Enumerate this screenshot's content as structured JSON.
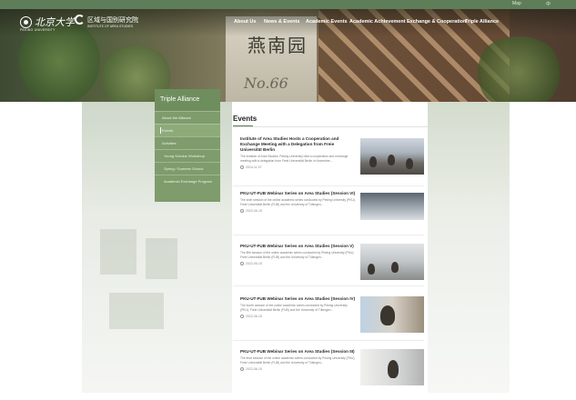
{
  "topbar": {
    "util_links": [
      "Map",
      "中"
    ]
  },
  "logos": {
    "pku_cn": "北京大学",
    "pku_en": "PEKING UNIVERSITY",
    "ias_cn": "区域与国别研究院",
    "ias_en": "INSTITUTE OF AREA STUDIES"
  },
  "nav": {
    "items": [
      "About Us",
      "News & Events",
      "Academic Events",
      "Academic Achievement",
      "Exchange & Cooperation",
      "Triple Alliance"
    ]
  },
  "hero": {
    "door_text": "燕南园",
    "door_number": "No.66"
  },
  "sidebar": {
    "title": "Triple Alliance",
    "items": [
      {
        "label": "About the Alliance",
        "active": false
      },
      {
        "label": "Events",
        "active": true
      },
      {
        "label": "Activities",
        "active": false
      },
      {
        "label": "Young Scholar Workshop",
        "active": false
      },
      {
        "label": "Spring / Summer School",
        "active": false
      },
      {
        "label": "Academic Exchange Program",
        "active": false
      }
    ]
  },
  "main": {
    "heading": "Events",
    "events": [
      {
        "title": "Institute of Area Studies Hosts a Cooperation and Exchange Meeting with a Delegation from Freie Universität Berlin",
        "desc": "The Institute of Area Studies, Peking University held a cooperation and exchange meeting with a delegation from Freie Universität Berlin in November...",
        "date": "2024-11-07"
      },
      {
        "title": "PKU-UT-FUB Webinar Series on Area Studies (Session VI)",
        "desc": "The sixth session of the online academic series conducted by Peking University (PKU), Freie Universität Berlin (FUB) and the University of Tübingen...",
        "date": "2022-06-15"
      },
      {
        "title": "PKU-UT-FUB Webinar Series on Area Studies (Session V)",
        "desc": "The fifth session of the online academic series conducted by Peking University (PKU), Freie Universität Berlin (FUB) and the University of Tübingen...",
        "date": "2022-06-15"
      },
      {
        "title": "PKU-UT-FUB Webinar Series on Area Studies (Session IV)",
        "desc": "The fourth session of the online academic series conducted by Peking University (PKU), Freie Universität Berlin (FUB) and the University of Tübingen...",
        "date": "2022-06-15"
      },
      {
        "title": "PKU-UT-FUB Webinar Series on Area Studies (Session III)",
        "desc": "The third session of the online academic series conducted by Peking University (PKU), Freie Universität Berlin (FUB) and the University of Tübingen...",
        "date": "2022-06-15"
      }
    ]
  },
  "colors": {
    "brand_green": "#5e7d59",
    "sidebar_green": "#7e9c6c",
    "active_green": "#8dab79"
  }
}
